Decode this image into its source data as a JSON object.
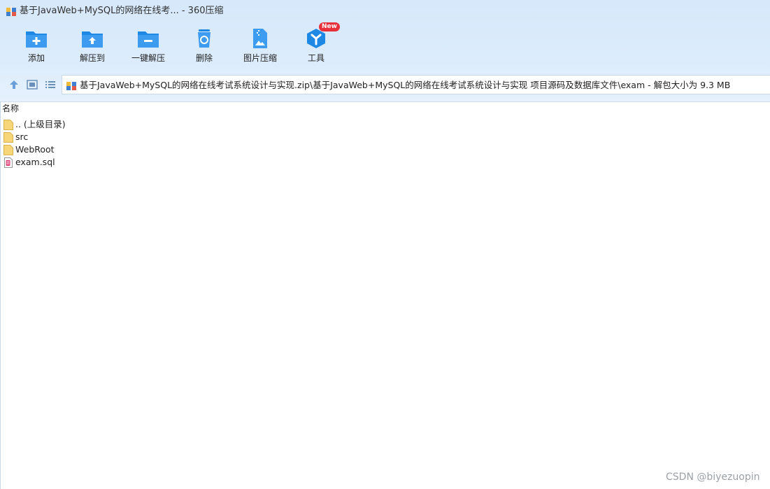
{
  "window": {
    "title": "基于JavaWeb+MySQL的网络在线考... - 360压缩"
  },
  "toolbar": {
    "items": [
      {
        "label": "添加",
        "icon": "folder-plus-icon"
      },
      {
        "label": "解压到",
        "icon": "folder-upload-icon"
      },
      {
        "label": "一键解压",
        "icon": "folder-minus-icon"
      },
      {
        "label": "删除",
        "icon": "recycle-bin-icon"
      },
      {
        "label": "图片压缩",
        "icon": "zip-image-icon"
      },
      {
        "label": "工具",
        "icon": "tools-hexagon-icon",
        "badge": "New"
      }
    ]
  },
  "nav": {
    "path": "基于JavaWeb+MySQL的网络在线考试系统设计与实现.zip\\基于JavaWeb+MySQL的网络在线考试系统设计与实现 项目源码及数据库文件\\exam - 解包大小为 9.3 MB"
  },
  "file_list": {
    "column_name": "名称",
    "items": [
      {
        "name": ".. (上级目录)",
        "type": "folder"
      },
      {
        "name": "src",
        "type": "folder"
      },
      {
        "name": "WebRoot",
        "type": "folder"
      },
      {
        "name": "exam.sql",
        "type": "sql-file"
      }
    ]
  },
  "watermark": "CSDN @biyezuopin",
  "colors": {
    "accent_blue": "#1e88e5",
    "header_bg": "#d9eafb",
    "folder_yellow": "#f7d67a",
    "badge_red": "#e8313a"
  }
}
